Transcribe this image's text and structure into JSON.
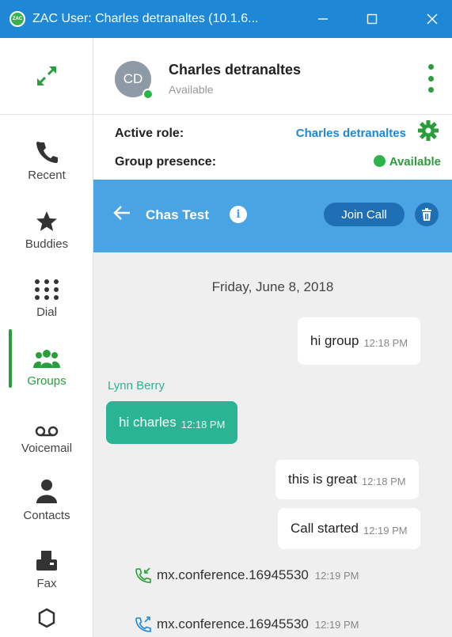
{
  "window": {
    "title": "ZAC User: Charles detranaltes (10.1.6...",
    "app_icon_text": "ZAC"
  },
  "sidebar": {
    "items": [
      {
        "label": "Recent",
        "icon": "phone-icon"
      },
      {
        "label": "Buddies",
        "icon": "star-icon"
      },
      {
        "label": "Dial",
        "icon": "dialpad-icon"
      },
      {
        "label": "Groups",
        "icon": "groups-icon",
        "active": true
      },
      {
        "label": "Voicemail",
        "icon": "voicemail-icon"
      },
      {
        "label": "Contacts",
        "icon": "person-icon"
      },
      {
        "label": "Fax",
        "icon": "fax-icon"
      }
    ]
  },
  "header": {
    "avatar_initials": "CD",
    "name": "Charles detranaltes",
    "status": "Available"
  },
  "role": {
    "active_role_label": "Active role:",
    "active_role_value": "Charles detranaltes",
    "group_presence_label": "Group presence:",
    "group_presence_value": "Available"
  },
  "conversation": {
    "title": "Chas Test",
    "join_call_label": "Join Call",
    "date": "Friday, June 8, 2018",
    "messages": [
      {
        "direction": "out",
        "text": "hi group",
        "time": "12:18 PM"
      },
      {
        "direction": "in",
        "sender": "Lynn Berry",
        "text": "hi charles",
        "time": "12:18 PM"
      },
      {
        "direction": "out",
        "text": "this is great",
        "time": "12:18 PM"
      },
      {
        "direction": "out",
        "text": "Call started",
        "time": "12:19 PM"
      }
    ],
    "calls": [
      {
        "text": "mx.conference.16945530",
        "time": "12:19 PM",
        "kind": "incoming-call-icon"
      },
      {
        "text": "mx.conference.16945530",
        "time": "12:19 PM",
        "kind": "outgoing-call-icon"
      }
    ]
  },
  "colors": {
    "titlebar": "#1e88d6",
    "accent_green": "#2a9d3c",
    "conv_bar": "#4aa3e3",
    "incoming_bubble": "#2bb493"
  }
}
